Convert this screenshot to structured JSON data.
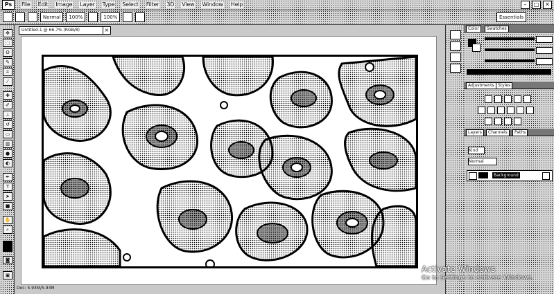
{
  "app": {
    "logo": "Ps"
  },
  "menu": {
    "items": [
      "File",
      "Edit",
      "Image",
      "Layer",
      "Type",
      "Select",
      "Filter",
      "3D",
      "View",
      "Window",
      "Help"
    ]
  },
  "window_controls": {
    "minimize": "–",
    "maximize": "□",
    "close": "✕"
  },
  "options_bar": {
    "mode_label": "Normal",
    "opacity_label": "100%",
    "flow_label": "100%",
    "preset_label": "Essentials"
  },
  "document": {
    "tab_title": "Untitled-1 @ 66.7% (RGB/8)",
    "close_glyph": "×",
    "status": "Doc: 5.93M/5.93M"
  },
  "panels": {
    "color_tab": "Color",
    "swatches_tab": "Swatches",
    "adjustments_tab": "Adjustments",
    "styles_tab": "Styles",
    "layers_tab": "Layers",
    "channels_tab": "Channels",
    "paths_tab": "Paths",
    "kind_label": "Kind",
    "normal_label": "Normal",
    "layer_name": "Background"
  },
  "watermark": {
    "title": "Activate Windows",
    "subtitle": "Go to Settings to activate Windows."
  },
  "icons": {
    "tools": [
      "move-tool-icon",
      "marquee-tool-icon",
      "lasso-tool-icon",
      "quick-select-tool-icon",
      "crop-tool-icon",
      "eyedropper-tool-icon",
      "healing-tool-icon",
      "brush-tool-icon",
      "clone-stamp-tool-icon",
      "history-brush-tool-icon",
      "eraser-tool-icon",
      "gradient-tool-icon",
      "blur-tool-icon",
      "dodge-tool-icon",
      "pen-tool-icon",
      "type-tool-icon",
      "path-select-tool-icon",
      "shape-tool-icon",
      "hand-tool-icon",
      "zoom-tool-icon",
      "foreground-color-icon",
      "quick-mask-icon",
      "screen-mode-icon"
    ]
  }
}
